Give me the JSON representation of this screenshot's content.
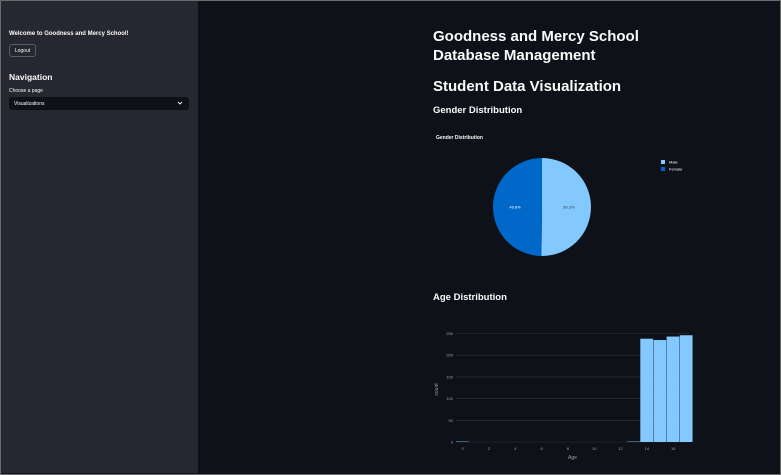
{
  "sidebar": {
    "welcome": "Welcome to Goodness and Mercy School!",
    "logout_label": "Logout",
    "nav_title": "Navigation",
    "choose_label": "Choose a page",
    "selected_page": "Visualizations"
  },
  "main": {
    "title_line1": "Goodness and Mercy School",
    "title_line2": "Database Management",
    "subtitle": "Student Data Visualization",
    "gender_heading": "Gender Distribution",
    "age_heading": "Age Distribution"
  },
  "colors": {
    "male": "#83c9ff",
    "female": "#0068c9",
    "background": "#0e1117",
    "sidebar": "#262730"
  },
  "chart_data": [
    {
      "type": "pie",
      "title": "Gender Distribution",
      "labels": [
        "Male",
        "Female"
      ],
      "values": [
        50.2,
        49.8
      ],
      "value_labels": [
        "50.2%",
        "49.8%"
      ],
      "legend_position": "top-right"
    },
    {
      "type": "bar",
      "xlabel": "Age",
      "ylabel": "count",
      "x_ticks": [
        "0",
        "2",
        "4",
        "6",
        "8",
        "10",
        "12",
        "14",
        "16"
      ],
      "y_ticks": [
        "0",
        "50",
        "100",
        "150",
        "200",
        "250"
      ],
      "xlim": [
        -0.5,
        17.2
      ],
      "ylim": [
        0,
        265
      ],
      "bars": [
        {
          "x": 0,
          "count": 1
        },
        {
          "x": 13,
          "count": 1
        },
        {
          "x": 14,
          "count": 238
        },
        {
          "x": 15,
          "count": 235
        },
        {
          "x": 16,
          "count": 243
        },
        {
          "x": 17,
          "count": 246
        }
      ],
      "grid": true
    }
  ]
}
